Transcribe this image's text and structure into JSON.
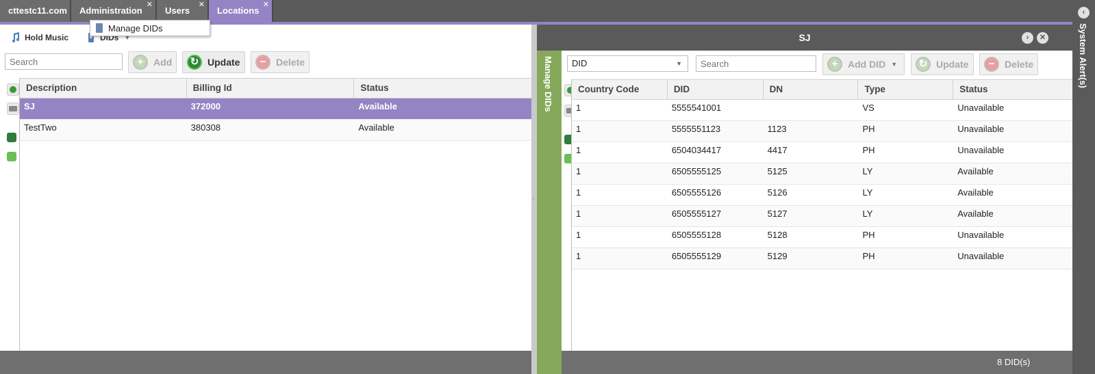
{
  "tabs": [
    {
      "label": "cttestc11.com",
      "closable": false,
      "active": false
    },
    {
      "label": "Administration",
      "closable": true,
      "active": false
    },
    {
      "label": "Users",
      "closable": true,
      "active": false
    },
    {
      "label": "Locations",
      "closable": true,
      "active": true
    }
  ],
  "left": {
    "toolbar": {
      "hold_music": "Hold Music",
      "dids": "DIDs"
    },
    "dropdown": {
      "manage_dids": "Manage DIDs"
    },
    "search_placeholder": "Search",
    "buttons": {
      "add": "Add",
      "update": "Update",
      "delete": "Delete"
    },
    "columns": [
      "Description",
      "Billing Id",
      "Status"
    ],
    "rows": [
      {
        "description": "SJ",
        "billing_id": "372000",
        "status": "Available",
        "selected": true
      },
      {
        "description": "TestTwo",
        "billing_id": "380308",
        "status": "Available",
        "selected": false
      }
    ]
  },
  "right": {
    "title": "SJ",
    "vertical_tab": "Manage DIDs",
    "filter_select": "DID",
    "search_placeholder": "Search",
    "buttons": {
      "add_did": "Add DID",
      "update": "Update",
      "delete": "Delete"
    },
    "columns": [
      "Country Code",
      "DID",
      "DN",
      "Type",
      "Status"
    ],
    "rows": [
      {
        "country_code": "1",
        "did": "5555541001",
        "dn": "",
        "type": "VS",
        "status": "Unavailable"
      },
      {
        "country_code": "1",
        "did": "5555551123",
        "dn": "1123",
        "type": "PH",
        "status": "Unavailable"
      },
      {
        "country_code": "1",
        "did": "6504034417",
        "dn": "4417",
        "type": "PH",
        "status": "Unavailable"
      },
      {
        "country_code": "1",
        "did": "6505555125",
        "dn": "5125",
        "type": "LY",
        "status": "Available"
      },
      {
        "country_code": "1",
        "did": "6505555126",
        "dn": "5126",
        "type": "LY",
        "status": "Available"
      },
      {
        "country_code": "1",
        "did": "6505555127",
        "dn": "5127",
        "type": "LY",
        "status": "Available"
      },
      {
        "country_code": "1",
        "did": "6505555128",
        "dn": "5128",
        "type": "PH",
        "status": "Unavailable"
      },
      {
        "country_code": "1",
        "did": "6505555129",
        "dn": "5129",
        "type": "PH",
        "status": "Unavailable"
      }
    ],
    "footer_count": "8 DID(s)"
  },
  "system_alerts": "System Alert(s)",
  "colors": {
    "accent": "#9484c4",
    "green_tab": "#86a85b",
    "chrome": "#5a5a5a"
  }
}
